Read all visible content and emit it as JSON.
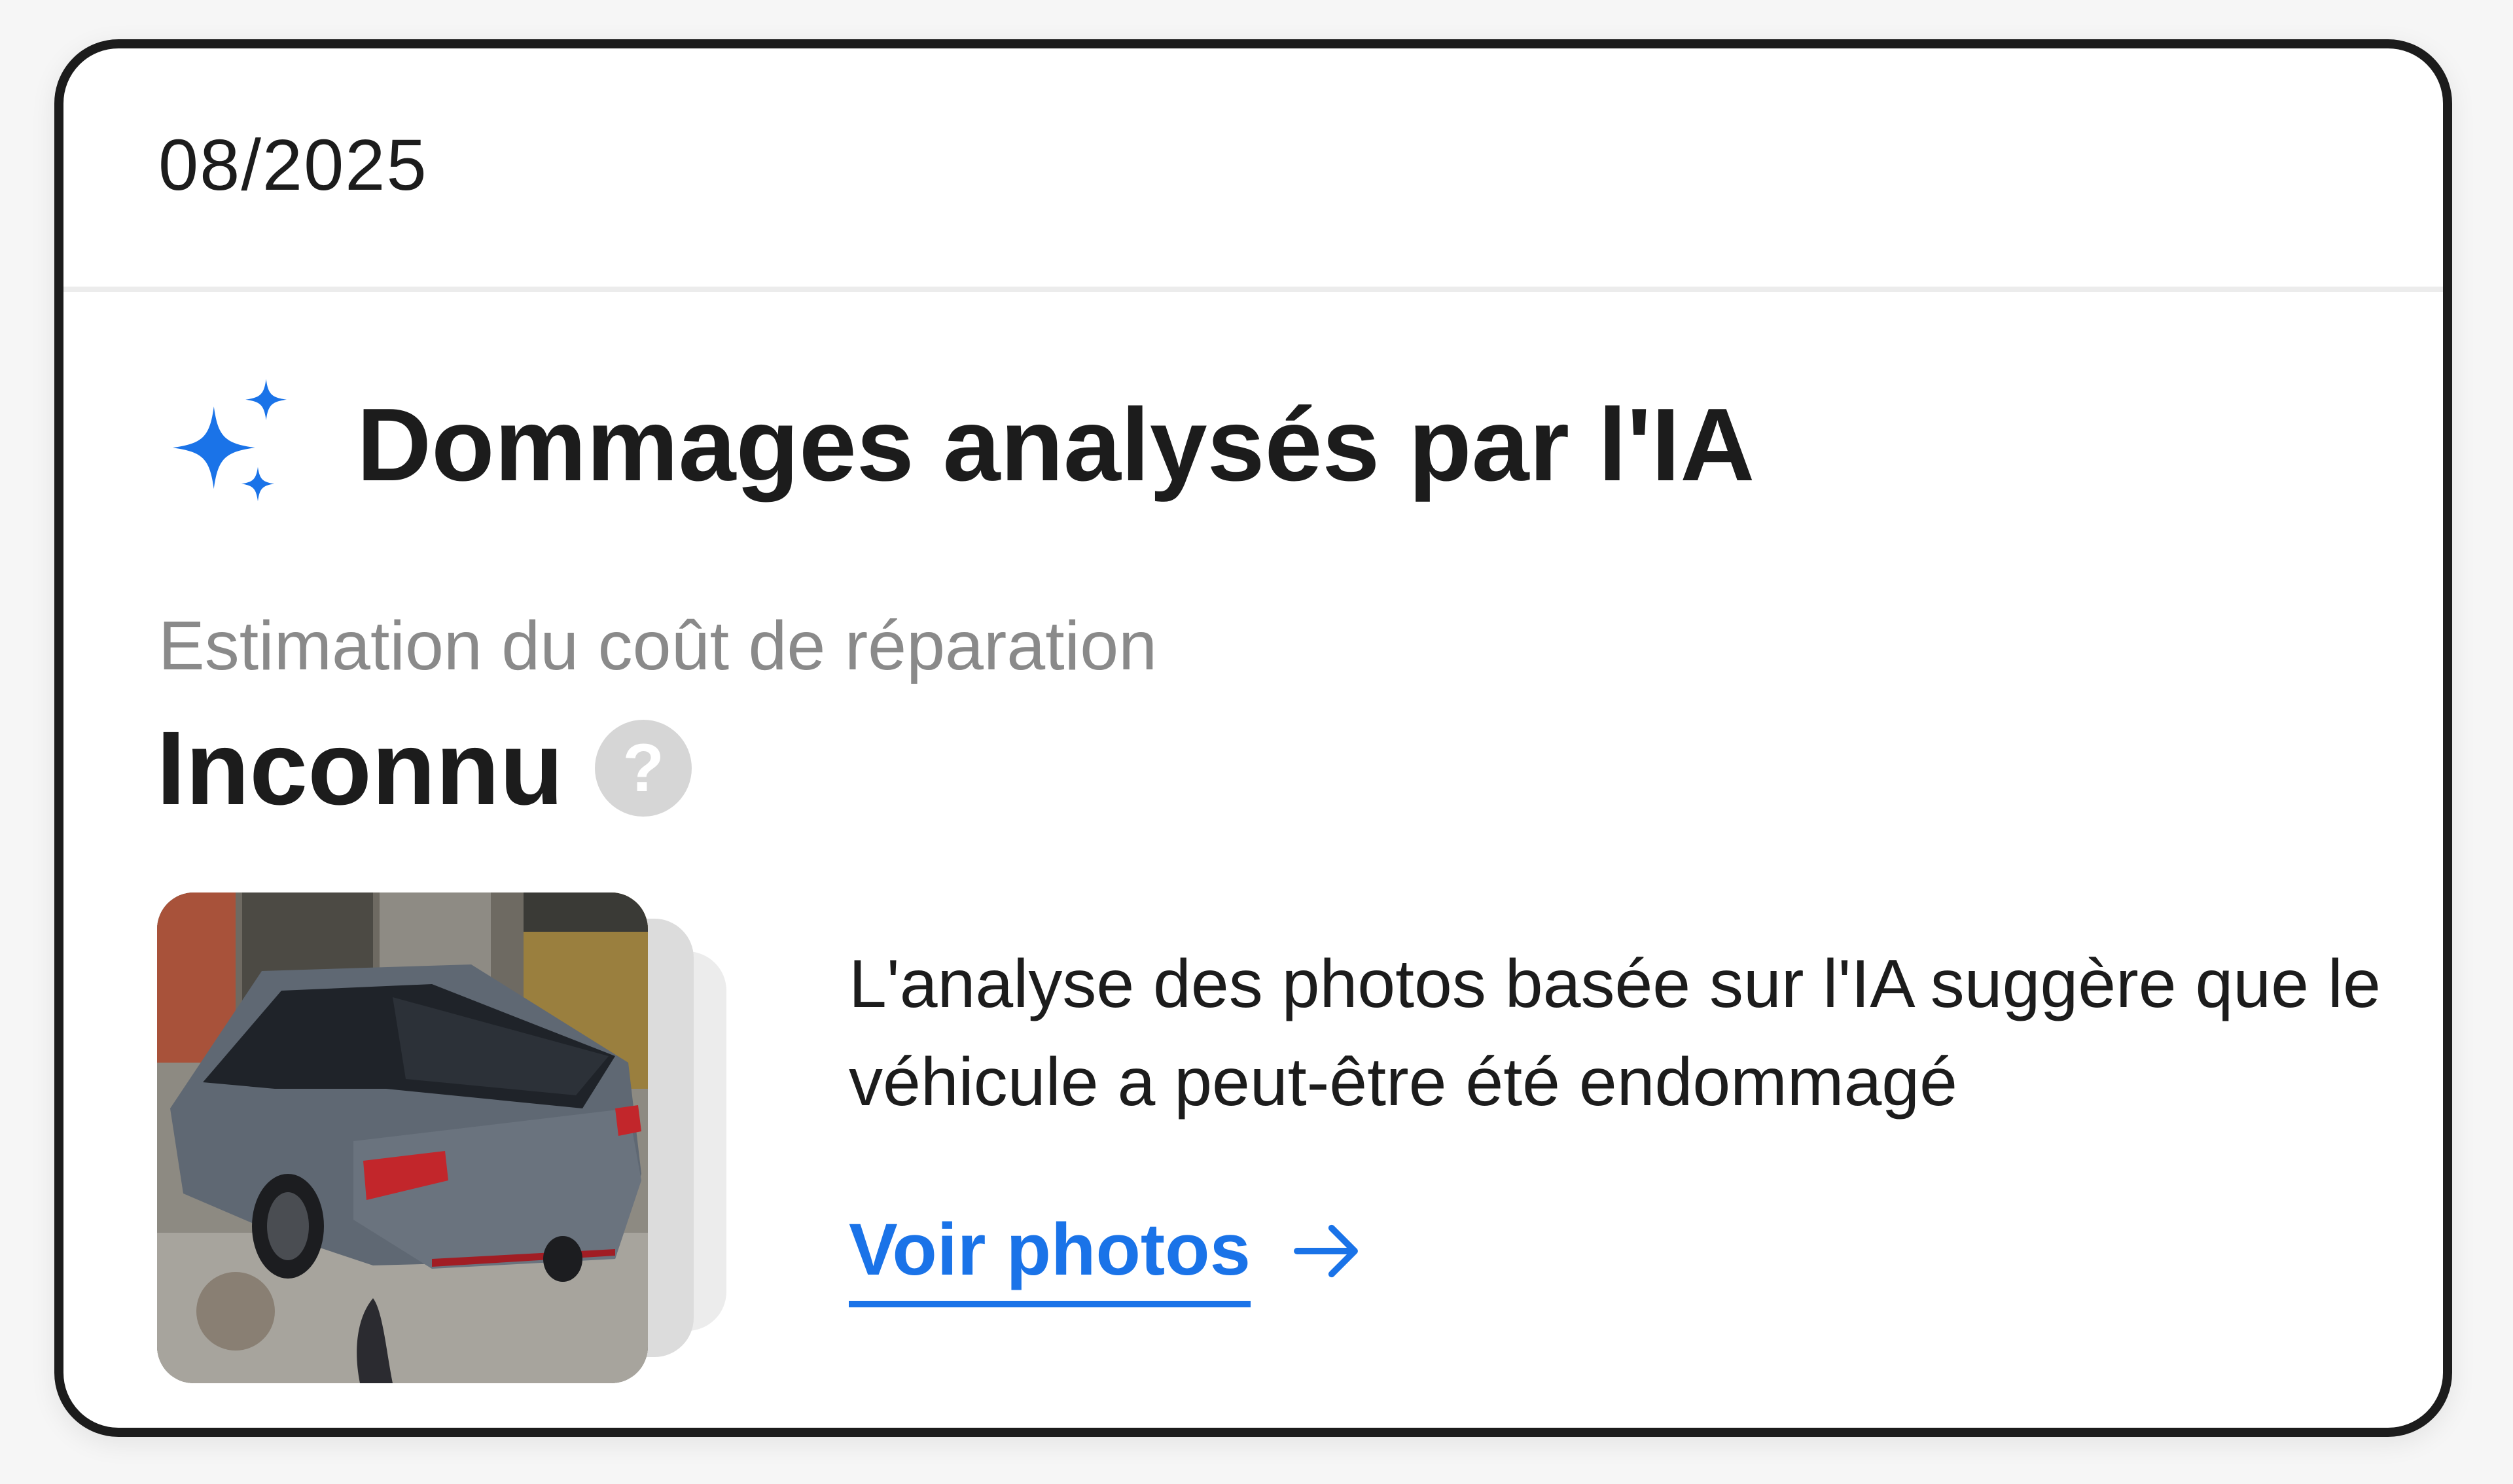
{
  "card": {
    "date": "08/2025",
    "title": "Dommages analysés par l'IA",
    "title_icon": "sparkle-icon",
    "subtitle": "Estimation du coût de réparation",
    "estimate_value": "Inconnu",
    "help_icon": "help-icon",
    "help_glyph": "?",
    "photo_icon": "car-photo",
    "description": "L'analyse des photos basée sur l'IA suggère que le véhicule a peut-être été endommagé",
    "link_label": "Voir photos",
    "link_icon": "arrow-right-icon"
  },
  "colors": {
    "accent": "#1a73e8",
    "text": "#1c1c1c",
    "muted": "#8a8a8a",
    "border": "#1c1c1c"
  }
}
